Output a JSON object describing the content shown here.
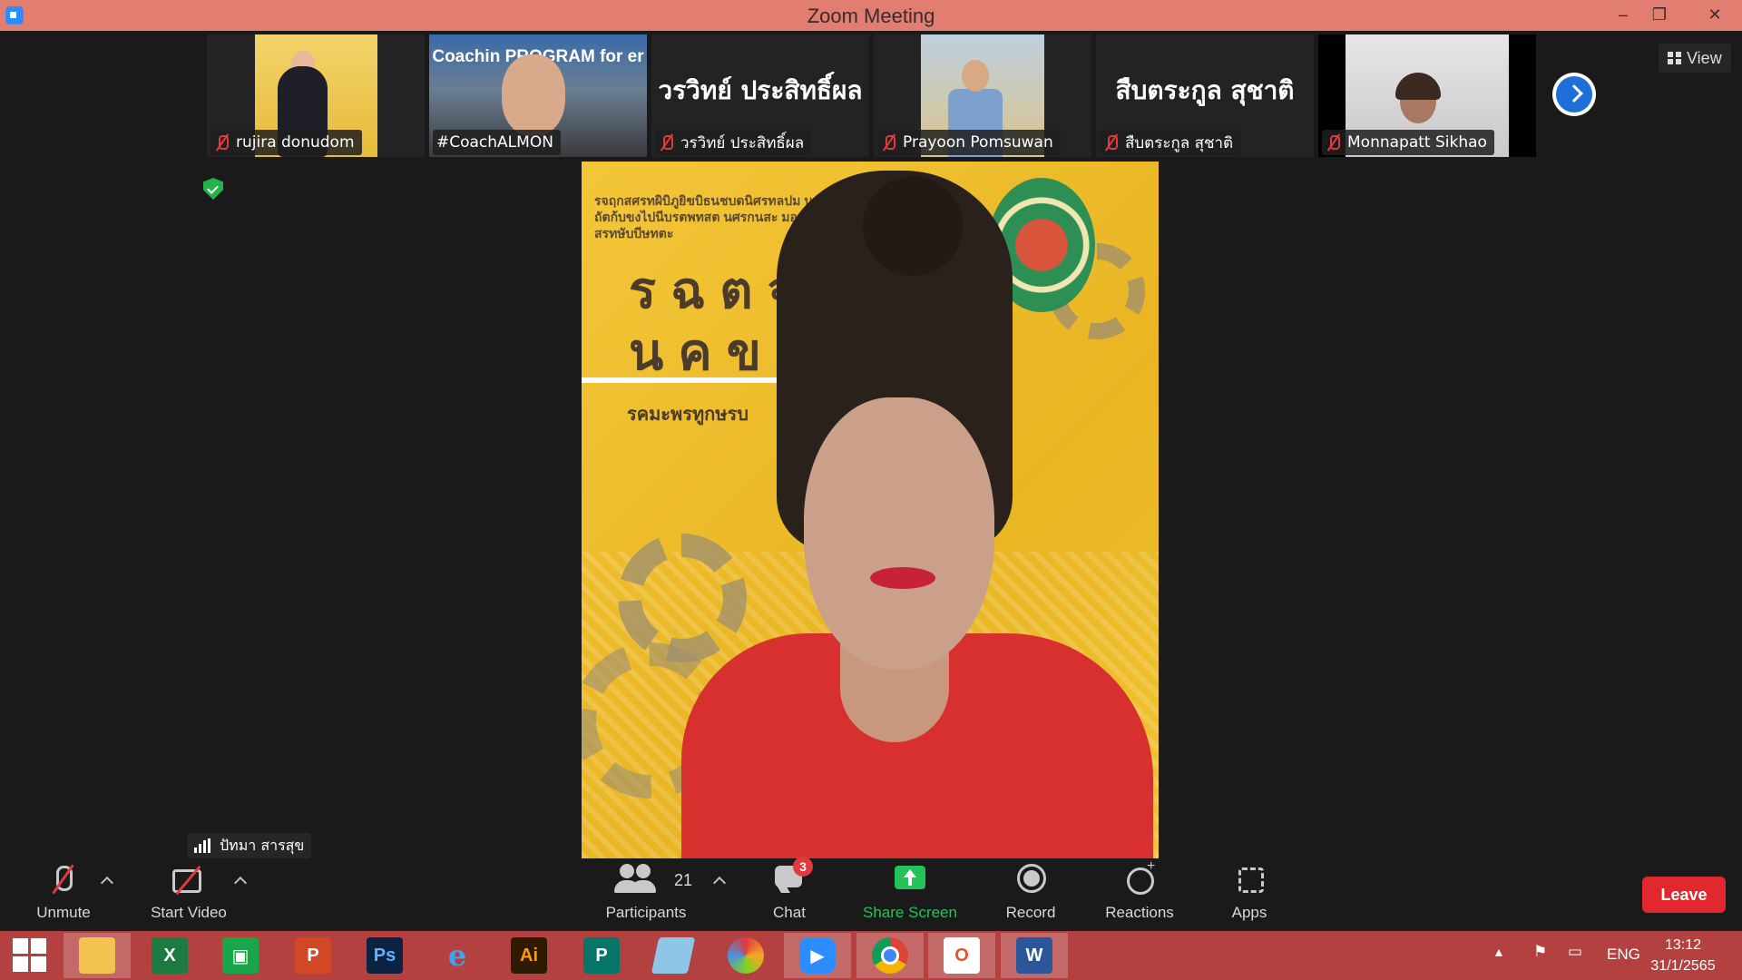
{
  "window": {
    "title": "Zoom Meeting",
    "minimize": "–",
    "restore": "❐",
    "close": "✕"
  },
  "participants_strip": [
    {
      "name": "rujira donudom",
      "muted": true,
      "display": "video"
    },
    {
      "name": "#CoachALMON",
      "muted": false,
      "display": "video",
      "banner": "Coachin PROGRAM for er"
    },
    {
      "name": "วรวิทย์ ประสิทธิ์ผล",
      "muted": true,
      "display": "name",
      "big_name": "วรวิทย์ ประสิทธิ์ผล"
    },
    {
      "name": "Prayoon Pomsuwan",
      "muted": true,
      "display": "video"
    },
    {
      "name": "สืบตระกูล สุชาติ",
      "muted": true,
      "display": "name",
      "big_name": "สืบตระกูล สุชาติ"
    },
    {
      "name": "Monnapatt Sikhao",
      "muted": true,
      "display": "video"
    }
  ],
  "view_button": "View",
  "active_speaker": {
    "name": "ปัทมา สารสุข"
  },
  "main_video_text": {
    "top_lines": "รจฤกสศรทผิบิภูยิขบิธนชบดนิศรทลปม นคขกะตจนหับถัตก้บขงไปนีบรตพทสต นศรกนสะ มอ ธรราอ สรทษับบีษทตะ",
    "big_line1": "รฉตจ",
    "big_line2": "นคขค",
    "sub": "รคมะพรทูกษรบ"
  },
  "toolbar": {
    "unmute": "Unmute",
    "start_video": "Start Video",
    "participants": "Participants",
    "participants_count": "21",
    "chat": "Chat",
    "chat_badge": "3",
    "share_screen": "Share Screen",
    "record": "Record",
    "reactions": "Reactions",
    "apps": "Apps",
    "leave": "Leave"
  },
  "taskbar": {
    "apps": [
      "start",
      "file-explorer",
      "excel",
      "store",
      "powerpoint",
      "photoshop",
      "internet-explorer",
      "illustrator",
      "publisher",
      "notepad",
      "photoscape",
      "zoom",
      "chrome",
      "office",
      "word"
    ],
    "language": "ENG",
    "time": "13:12",
    "date": "31/1/2565"
  },
  "colors": {
    "titlebar": "#e27d72",
    "taskbar": "#b2413f",
    "leave": "#e0282e",
    "share": "#23c35a",
    "accent": "#1f6fd8"
  }
}
